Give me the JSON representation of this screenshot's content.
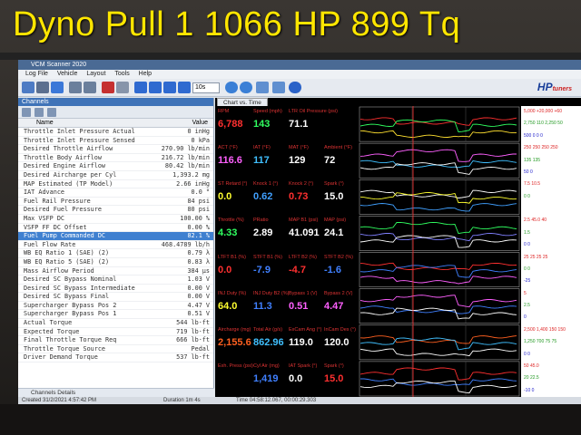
{
  "caption": "Dyno Pull 1 1066 HP 899 Tq",
  "window": {
    "title": "VCM Scanner 2020",
    "menu": [
      "Log File",
      "Vehicle",
      "Layout",
      "Tools",
      "Help"
    ],
    "zoom": "10s",
    "logo": "HP",
    "logo_sub": "tuners"
  },
  "channels": {
    "panel_title": "Channels",
    "col_name": "Name",
    "col_value": "Value",
    "rows": [
      {
        "name": "Throttle Inlet Pressure Actual",
        "value": "0 inHg"
      },
      {
        "name": "Throttle Inlet Pressure Sensed",
        "value": "0 kPa"
      },
      {
        "name": "Desired Throttle Airflow",
        "value": "270.90 lb/min"
      },
      {
        "name": "Throttle Body Airflow",
        "value": "216.72 lb/min"
      },
      {
        "name": "Desired Engine Airflow",
        "value": "80.42 lb/min"
      },
      {
        "name": "Desired Aircharge per Cyl",
        "value": "1,393.2 mg"
      },
      {
        "name": "MAP Estimated (TP Model)",
        "value": "2.66 inHg"
      },
      {
        "name": "IAT Advance",
        "value": "0.0 °"
      },
      {
        "name": "Fuel Rail Pressure",
        "value": "84 psi"
      },
      {
        "name": "Desired Fuel Pressure",
        "value": "80 psi"
      },
      {
        "name": "Max VSFP DC",
        "value": "100.00 %"
      },
      {
        "name": "VSFP FF DC Offset",
        "value": "0.00 %"
      },
      {
        "name": "Fuel Pump Commanded DC",
        "value": "82.1 %"
      },
      {
        "name": "Fuel Flow Rate",
        "value": "468.4789 lb/h"
      },
      {
        "name": "WB EQ Ratio 1 (SAE) (2)",
        "value": "0.79 λ"
      },
      {
        "name": "WB EQ Ratio 5 (SAE) (2)",
        "value": "0.83 λ"
      },
      {
        "name": "Mass Airflow Period",
        "value": "384 μs"
      },
      {
        "name": "Desired SC Bypass Nominal",
        "value": "1.03 V"
      },
      {
        "name": "Desired SC Bypass Intermediate",
        "value": "0.00 V"
      },
      {
        "name": "Desired SC Bypass Final",
        "value": "0.00 V"
      },
      {
        "name": "Supercharger Bypass Pos 2",
        "value": "4.47 V"
      },
      {
        "name": "Supercharger Bypass Pos 1",
        "value": "0.51 V"
      },
      {
        "name": "Actual Torque",
        "value": "544 lb·ft"
      },
      {
        "name": "Expected Torque",
        "value": "719 lb·ft"
      },
      {
        "name": "Final Throttle Torque Req",
        "value": "666 lb·ft"
      },
      {
        "name": "Throttle Torque Source",
        "value": "Pedal"
      },
      {
        "name": "Driver Demand Torque",
        "value": "537 lb·ft"
      }
    ],
    "footer": "Channels   Details"
  },
  "status": {
    "created": "Created 31/2/2021 4:57:42 PM",
    "duration": "Duration 1m 4s",
    "time": "Time 04:58:12.067, 00:00:29.303"
  },
  "chart": {
    "tab": "Chart vs. Time",
    "rows": [
      {
        "gauges": [
          {
            "label": "RPM",
            "value": "6,788",
            "color": "#ff3030"
          },
          {
            "label": "Speed (mph)",
            "value": "143",
            "color": "#30ff60"
          },
          {
            "label": "LTR Oil Pressure (psi)",
            "value": "71.1",
            "color": "#ffffff"
          }
        ],
        "axis": [
          "5,000 +20,000 +60",
          "2,750 110 2,250 50",
          "500 0 0 0"
        ]
      },
      {
        "gauges": [
          {
            "label": "ACT (°F)",
            "value": "116.6",
            "color": "#ff60ff"
          },
          {
            "label": "IAT (°F)",
            "value": "117",
            "color": "#40c0ff"
          },
          {
            "label": "MAT (°F)",
            "value": "129",
            "color": "#ffffff"
          },
          {
            "label": "Ambient (°F)",
            "value": "72",
            "color": "#ffffff"
          }
        ],
        "axis": [
          "250 250 250 250",
          "135 135",
          "50 0"
        ]
      },
      {
        "gauges": [
          {
            "label": "ST Retard (°)",
            "value": "0.0",
            "color": "#ffff30"
          },
          {
            "label": "Knock 1 (°)",
            "value": "0.62",
            "color": "#40a0ff"
          },
          {
            "label": "Knock 2 (°)",
            "value": "0.73",
            "color": "#ff3030"
          },
          {
            "label": "Spark (°)",
            "value": "15.0",
            "color": "#ffffff"
          }
        ],
        "axis": [
          "7.5 10.5",
          "0 0"
        ]
      },
      {
        "gauges": [
          {
            "label": "Throttle (%)",
            "value": "4.33",
            "color": "#30ff60"
          },
          {
            "label": "PRatio",
            "value": "2.89",
            "color": "#ffffff"
          },
          {
            "label": "MAP B1 (psi)",
            "value": "41.091",
            "color": "#ffffff"
          },
          {
            "label": "MAP (psi)",
            "value": "24.1",
            "color": "#ffffff"
          }
        ],
        "axis": [
          "2.5 45.0 40",
          "1.5",
          "0 0"
        ]
      },
      {
        "gauges": [
          {
            "label": "LTFT B1 (%)",
            "value": "0.0",
            "color": "#ff3030"
          },
          {
            "label": "STFT B1 (%)",
            "value": "-7.9",
            "color": "#4080ff"
          },
          {
            "label": "LTFT B2 (%)",
            "value": "-4.7",
            "color": "#ff3030"
          },
          {
            "label": "STFT B2 (%)",
            "value": "-1.6",
            "color": "#4080ff"
          }
        ],
        "axis": [
          "25 25 25 25",
          "0 0",
          "-25"
        ]
      },
      {
        "gauges": [
          {
            "label": "INJ Duty (%)",
            "value": "64.0",
            "color": "#ffff30"
          },
          {
            "label": "INJ Duty B2 (%)",
            "value": "11.3",
            "color": "#4080ff"
          },
          {
            "label": "Bypass 1 (V)",
            "value": "0.51",
            "color": "#ff60ff"
          },
          {
            "label": "Bypass 2 (V)",
            "value": "4.47",
            "color": "#ff60ff"
          }
        ],
        "axis": [
          "5",
          "2.5",
          "0"
        ]
      },
      {
        "gauges": [
          {
            "label": "Aircharge (mg)",
            "value": "2,155.6",
            "color": "#ff6020"
          },
          {
            "label": "Total Air (g/s)",
            "value": "862.96",
            "color": "#40c0ff"
          },
          {
            "label": "ExCam Ang (°)",
            "value": "119.0",
            "color": "#ffffff"
          },
          {
            "label": "InCam Des (°)",
            "value": "120.0",
            "color": "#ffffff"
          }
        ],
        "axis": [
          "2,500 1,400 150 150",
          "1,250 700 75 75",
          "0 0"
        ]
      },
      {
        "gauges": [
          {
            "label": "Exh. Press (psi)",
            "value": "",
            "color": "#ffffff"
          },
          {
            "label": "Cyl Air (mg)",
            "value": "1,419",
            "color": "#4080ff"
          },
          {
            "label": "IAT Spark (°)",
            "value": "0.0",
            "color": "#ffffff"
          },
          {
            "label": "Spark (°)",
            "value": "15.0",
            "color": "#ff3030"
          }
        ],
        "axis": [
          "50 45.0",
          "20 22.5",
          "-10 0"
        ]
      }
    ]
  }
}
